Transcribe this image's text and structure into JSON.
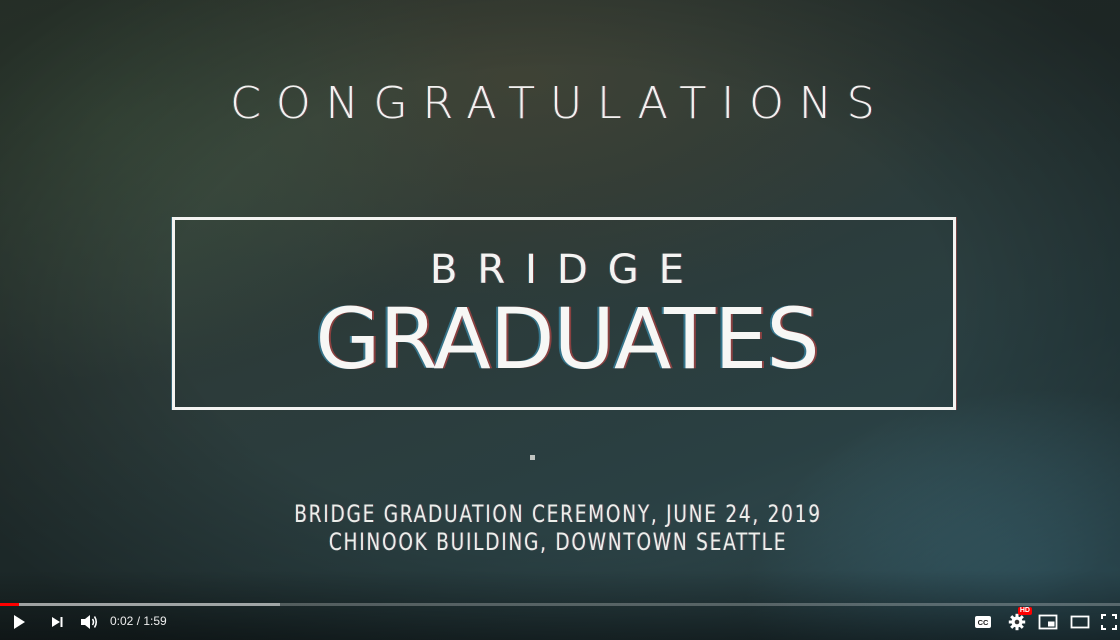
{
  "video": {
    "title_top": "CONGRATULATIONS",
    "box_line1": "BRIDGE",
    "box_line2": "GRADUATES",
    "event_line1": "BRIDGE GRADUATION CEREMONY, JUNE 24, 2019",
    "event_line2": "CHINOOK BUILDING, DOWNTOWN SEATTLE"
  },
  "controls": {
    "current_time": "0:02",
    "separator": "/",
    "duration": "1:59",
    "time_text": "0:02 / 1:59",
    "played_fraction": 0.0168,
    "buffered_fraction": 0.25,
    "cc_label": "CC",
    "hd_label": "HD",
    "accent_color": "#ff0000",
    "icons": [
      "play-icon",
      "next-icon",
      "volume-icon",
      "subtitles-icon",
      "settings-icon",
      "miniplayer-icon",
      "theater-icon",
      "fullscreen-icon"
    ]
  }
}
